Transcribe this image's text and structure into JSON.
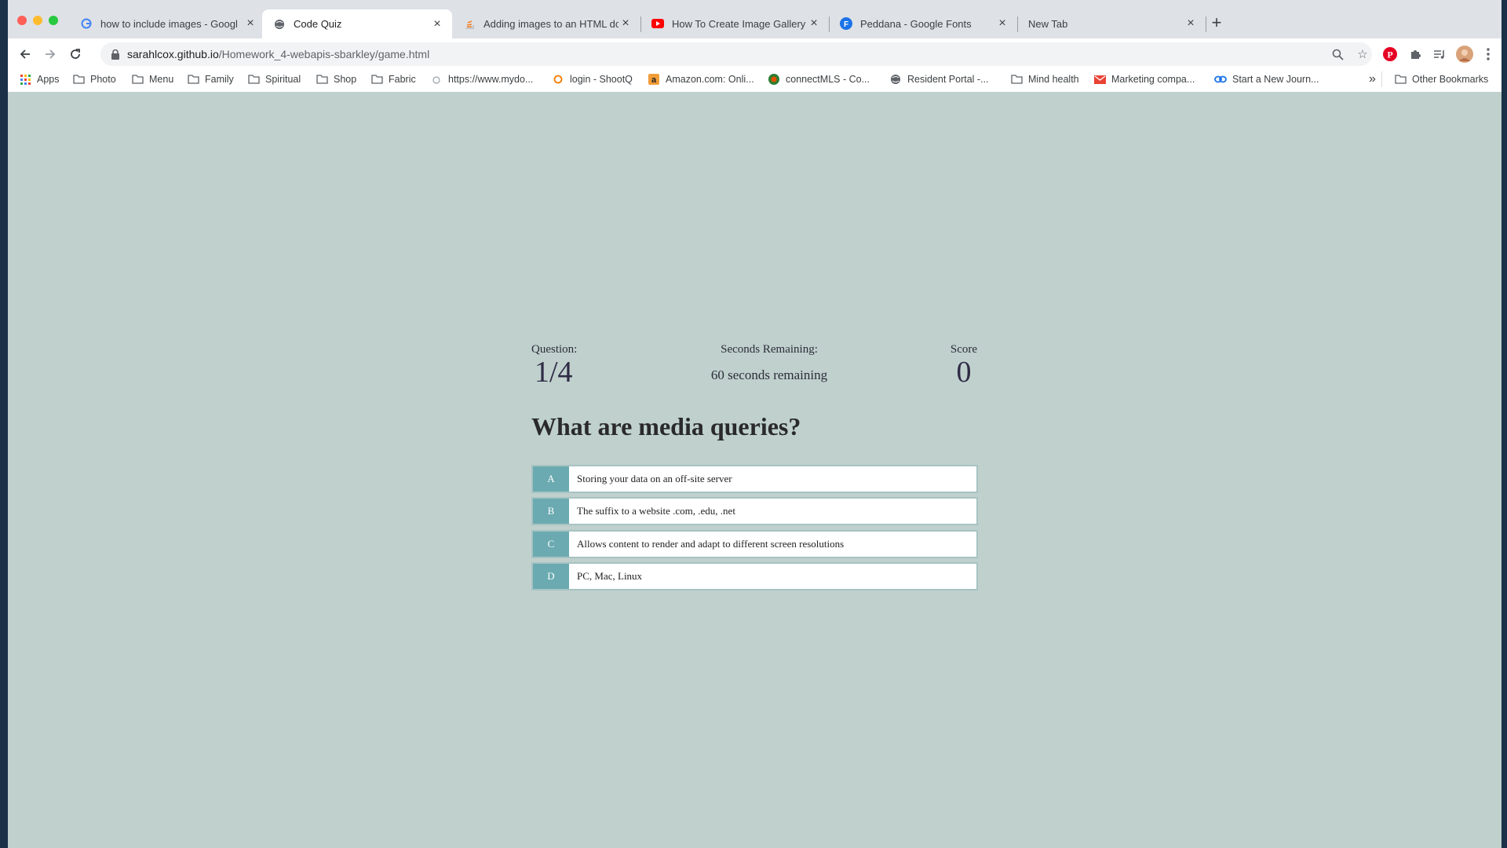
{
  "browser": {
    "tabs": [
      {
        "title": "how to include images - Googl",
        "icon": "google-icon"
      },
      {
        "title": "Code Quiz",
        "icon": "globe-icon"
      },
      {
        "title": "Adding images to an HTML doc",
        "icon": "stackoverflow-icon"
      },
      {
        "title": "How To Create Image Gallery U",
        "icon": "youtube-icon"
      },
      {
        "title": "Peddana - Google Fonts",
        "icon": "google-fonts-icon"
      },
      {
        "title": "New Tab",
        "icon": ""
      }
    ],
    "active_tab": 1,
    "url_host": "sarahlcox.github.io",
    "url_path": "/Homework_4-webapis-sbarkley/game.html",
    "bookmarks": [
      {
        "label": "Apps",
        "icon": "apps-grid-icon"
      },
      {
        "label": "Photo",
        "icon": "folder-icon"
      },
      {
        "label": "Menu",
        "icon": "folder-icon"
      },
      {
        "label": "Family",
        "icon": "folder-icon"
      },
      {
        "label": "Spiritual",
        "icon": "folder-icon"
      },
      {
        "label": "Shop",
        "icon": "folder-icon"
      },
      {
        "label": "Fabric",
        "icon": "folder-icon"
      },
      {
        "label": "https://www.mydo...",
        "icon": "page-icon"
      },
      {
        "label": "login - ShootQ",
        "icon": "shootq-icon"
      },
      {
        "label": "Amazon.com: Onli...",
        "icon": "amazon-icon"
      },
      {
        "label": "connectMLS - Co...",
        "icon": "connectmls-icon"
      },
      {
        "label": "Resident Portal -...",
        "icon": "globe-icon"
      },
      {
        "label": "Mind health",
        "icon": "folder-icon"
      },
      {
        "label": "Marketing compa...",
        "icon": "gmail-icon"
      },
      {
        "label": "Start a New Journ...",
        "icon": "link-icon"
      }
    ],
    "overflow_label": "»",
    "other_bookmarks": "Other Bookmarks"
  },
  "quiz": {
    "question_label": "Question:",
    "question_counter": "1/4",
    "timer_label": "Seconds Remaining:",
    "timer_text": "60 seconds remaining",
    "score_label": "Score",
    "score_value": "0",
    "question_text": "What are media queries?",
    "choices": [
      {
        "prefix": "A",
        "text": "Storing your data on an off-site server"
      },
      {
        "prefix": "B",
        "text": "The suffix to a website .com, .edu, .net"
      },
      {
        "prefix": "C",
        "text": "Allows content to render and adapt to different screen resolutions"
      },
      {
        "prefix": "D",
        "text": "PC, Mac, Linux"
      }
    ]
  },
  "colors": {
    "page_background": "#bfd0cd",
    "choice_prefix": "#6aaab0",
    "choice_border": "#a7c3c3"
  }
}
